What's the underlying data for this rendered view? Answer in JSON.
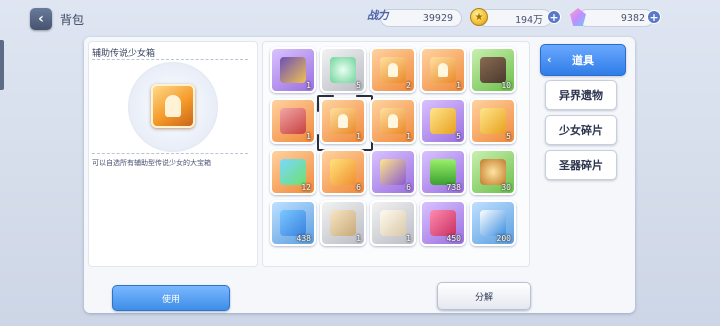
{
  "header": {
    "title": "背包",
    "power_label": "战力",
    "power_value": "39929",
    "coins_value": "194万",
    "gems_value": "9382"
  },
  "detail": {
    "item_name": "辅助传说少女箱",
    "description": "可以自选所有辅助型传说少女的大宝箱"
  },
  "inventory": [
    {
      "rarity": "purple",
      "icon": "card-pack-icon",
      "qty": "1"
    },
    {
      "rarity": "silver",
      "icon": "clover-orb-icon",
      "qty": "5"
    },
    {
      "rarity": "orange",
      "icon": "girl-box-icon",
      "qty": "2"
    },
    {
      "rarity": "orange",
      "icon": "girl-box-icon",
      "qty": "1"
    },
    {
      "rarity": "green",
      "icon": "treasure-chest-icon",
      "qty": "10"
    },
    {
      "rarity": "orange",
      "icon": "medkit-box-icon",
      "qty": "1"
    },
    {
      "rarity": "orange",
      "icon": "girl-box-icon",
      "qty": "1"
    },
    {
      "rarity": "orange",
      "icon": "girl-box-icon",
      "qty": "1"
    },
    {
      "rarity": "purple",
      "icon": "shard-card-icon",
      "qty": "5"
    },
    {
      "rarity": "orange",
      "icon": "shard-card-icon",
      "qty": "5"
    },
    {
      "rarity": "orange",
      "icon": "ticket-icon",
      "qty": "12"
    },
    {
      "rarity": "orange",
      "icon": "gold-card-icon",
      "qty": "6"
    },
    {
      "rarity": "purple",
      "icon": "purple-card-icon",
      "qty": "6"
    },
    {
      "rarity": "purple",
      "icon": "potion-icon",
      "qty": "738"
    },
    {
      "rarity": "green",
      "icon": "coin-icon",
      "qty": "30"
    },
    {
      "rarity": "blue",
      "icon": "candy-icon",
      "qty": "438"
    },
    {
      "rarity": "silver",
      "icon": "envelope-icon",
      "qty": "1"
    },
    {
      "rarity": "silver",
      "icon": "scroll-icon",
      "qty": "1"
    },
    {
      "rarity": "purple",
      "icon": "ribbon-icon",
      "qty": "450"
    },
    {
      "rarity": "blue",
      "icon": "flag-icon",
      "qty": "200"
    }
  ],
  "tabs": [
    {
      "label": "道具",
      "active": true
    },
    {
      "label": "异界遗物",
      "active": false
    },
    {
      "label": "少女碎片",
      "active": false
    },
    {
      "label": "圣器碎片",
      "active": false
    }
  ],
  "actions": {
    "use_label": "使用",
    "decompose_label": "分解"
  }
}
